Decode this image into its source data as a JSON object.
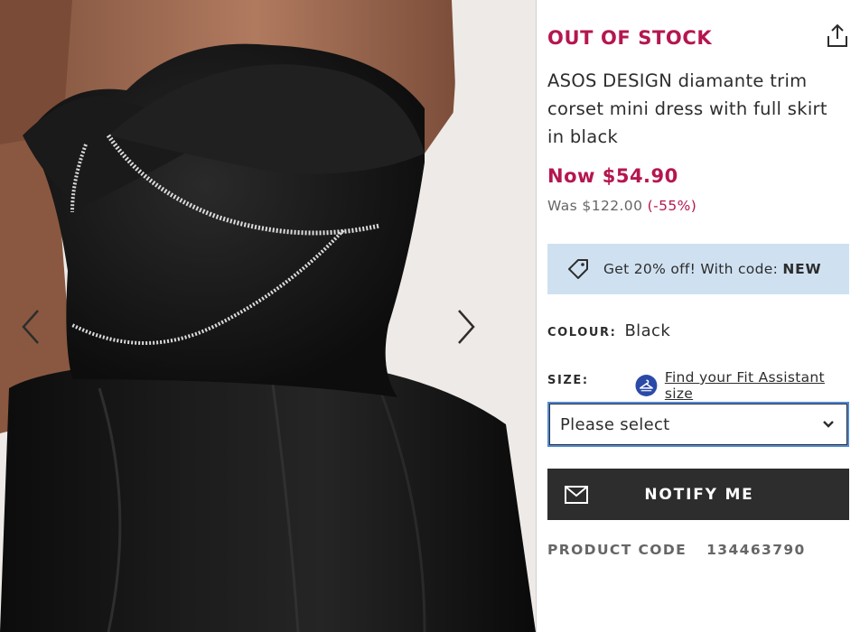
{
  "gallery": {
    "image_alt": "Model wearing black corset mini dress with diamante trim",
    "prev_icon": "chevron-left-icon",
    "next_icon": "chevron-right-icon"
  },
  "product": {
    "stock_status": "OUT OF STOCK",
    "title": "ASOS DESIGN diamante trim corset mini dress with full skirt in black",
    "price_now": "Now $54.90",
    "price_was": "Was $122.00",
    "discount": "(-55%)",
    "product_code_label": "PRODUCT CODE",
    "product_code": "134463790"
  },
  "promo": {
    "text": "Get 20% off! With code:",
    "code": "NEW",
    "icon": "price-tag-icon"
  },
  "colour": {
    "label": "COLOUR:",
    "value": "Black"
  },
  "size": {
    "label": "SIZE:",
    "fit_assistant_link": "Find your Fit Assistant size",
    "selected": "Please select"
  },
  "actions": {
    "notify_label": "NOTIFY ME",
    "share_icon": "share-icon"
  },
  "colors": {
    "accent": "#b5164f",
    "promo_bg": "#cfe1f1",
    "button_bg": "#2d2d2d",
    "focus_ring": "#4f8bd6"
  }
}
